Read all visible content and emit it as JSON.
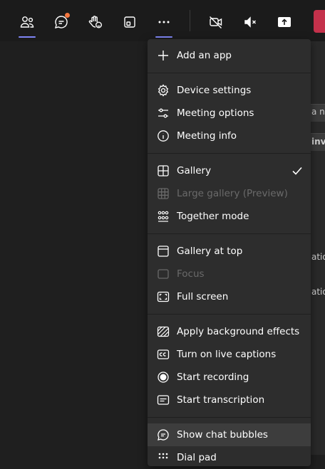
{
  "toolbar": {
    "people_icon": "people-icon",
    "chat_icon": "chat-icon",
    "react_icon": "raise-hand-icon",
    "rooms_icon": "breakout-rooms-icon",
    "more_icon": "more-actions-icon",
    "camera_icon": "camera-off-icon",
    "mic_icon": "mic-muted-icon",
    "share_icon": "share-screen-icon"
  },
  "side_panel": {
    "snippet_1": "a nu",
    "snippet_2": "invi",
    "snippet_3": "ation",
    "snippet_4": "ation"
  },
  "menu": {
    "add_app": "Add an app",
    "device_settings": "Device settings",
    "meeting_options": "Meeting options",
    "meeting_info": "Meeting info",
    "gallery": "Gallery",
    "large_gallery": "Large gallery (Preview)",
    "together_mode": "Together mode",
    "gallery_top": "Gallery at top",
    "focus": "Focus",
    "full_screen": "Full screen",
    "bg_effects": "Apply background effects",
    "live_captions": "Turn on live captions",
    "start_recording": "Start recording",
    "start_transcription": "Start transcription",
    "chat_bubbles": "Show chat bubbles",
    "dial_pad": "Dial pad"
  },
  "colors": {
    "accent": "#7f85f5",
    "notification": "#f4773f",
    "leave": "#c4314b",
    "menu_bg": "#2d2d2d"
  }
}
